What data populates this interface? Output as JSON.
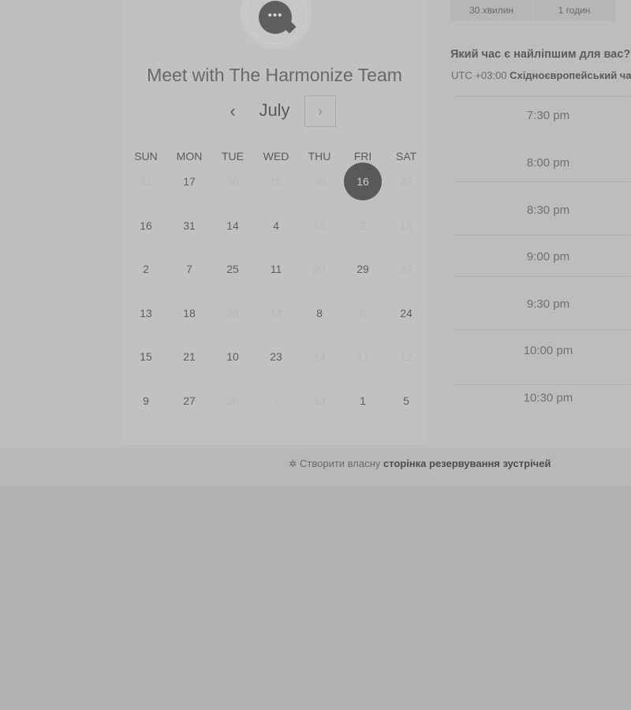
{
  "calendar": {
    "title": "Meet with The Harmonize Team",
    "month": "July",
    "prev_icon": "chevron-left-icon",
    "next_icon": "chevron-right-icon",
    "weekdays": [
      "SUN",
      "MON",
      "TUE",
      "WED",
      "THU",
      "FRI",
      "SAT"
    ],
    "weeks": [
      [
        {
          "d": "31",
          "muted": true
        },
        {
          "d": "17",
          "muted": false
        },
        {
          "d": "30",
          "muted": true
        },
        {
          "d": "15",
          "muted": true
        },
        {
          "d": "30",
          "muted": true
        },
        {
          "d": "16",
          "muted": false,
          "selected": true
        },
        {
          "d": "27",
          "muted": true
        }
      ],
      [
        {
          "d": "16",
          "muted": false
        },
        {
          "d": "31",
          "muted": false
        },
        {
          "d": "14",
          "muted": false
        },
        {
          "d": "4",
          "muted": false
        },
        {
          "d": "10",
          "muted": true
        },
        {
          "d": "2",
          "muted": true
        },
        {
          "d": "16",
          "muted": true
        }
      ],
      [
        {
          "d": "2",
          "muted": false
        },
        {
          "d": "7",
          "muted": false
        },
        {
          "d": "25",
          "muted": false
        },
        {
          "d": "11",
          "muted": false
        },
        {
          "d": "20",
          "muted": true
        },
        {
          "d": "29",
          "muted": false
        },
        {
          "d": "22",
          "muted": true
        }
      ],
      [
        {
          "d": "13",
          "muted": false
        },
        {
          "d": "18",
          "muted": false
        },
        {
          "d": "29",
          "muted": true
        },
        {
          "d": "14",
          "muted": true
        },
        {
          "d": "8",
          "muted": false
        },
        {
          "d": "8",
          "muted": true
        },
        {
          "d": "24",
          "muted": false
        }
      ],
      [
        {
          "d": "15",
          "muted": false
        },
        {
          "d": "21",
          "muted": false
        },
        {
          "d": "10",
          "muted": false
        },
        {
          "d": "23",
          "muted": false
        },
        {
          "d": "14",
          "muted": true
        },
        {
          "d": "17",
          "muted": true
        },
        {
          "d": "12",
          "muted": true
        }
      ],
      [
        {
          "d": "9",
          "muted": false
        },
        {
          "d": "27",
          "muted": false
        },
        {
          "d": "20",
          "muted": true
        },
        {
          "d": "7",
          "muted": true
        },
        {
          "d": "13",
          "muted": true
        },
        {
          "d": "1",
          "muted": false
        },
        {
          "d": "5",
          "muted": false
        }
      ]
    ]
  },
  "durations": [
    "30 хвилин",
    "1 годин"
  ],
  "question": "Який час є найліпшим для вас?",
  "timezone": {
    "offset": "UTC +03:00",
    "name": "Східноєвропейський час"
  },
  "time_slots": [
    "7:30 pm",
    "8:00 pm",
    "8:30 pm",
    "9:00 pm",
    "9:30 pm",
    "10:00 pm",
    "10:30 pm"
  ],
  "footer": {
    "prefix": "Створити власну",
    "link": "сторінка резервування зустрічей",
    "icon": "sprocket-icon"
  }
}
